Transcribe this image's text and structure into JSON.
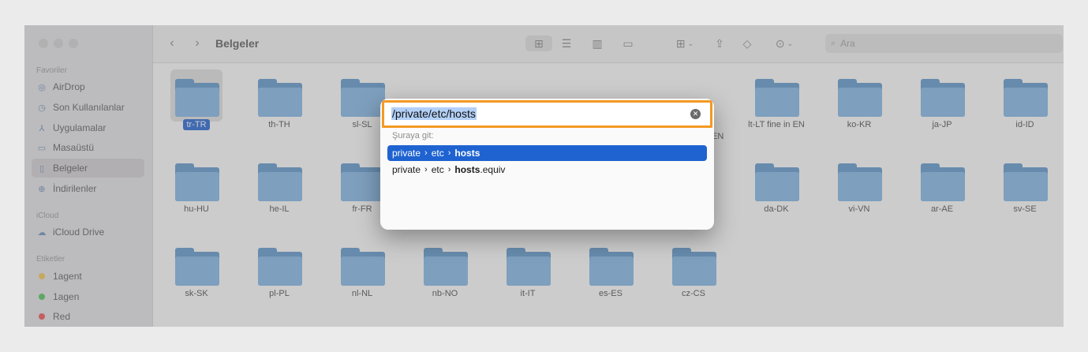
{
  "window": {
    "title": "Belgeler",
    "search_placeholder": "Ara"
  },
  "sidebar": {
    "sections": [
      {
        "title": "Favoriler",
        "items": [
          {
            "label": "AirDrop",
            "icon": "airdrop-icon"
          },
          {
            "label": "Son Kullanılanlar",
            "icon": "clock-icon"
          },
          {
            "label": "Uygulamalar",
            "icon": "apps-icon"
          },
          {
            "label": "Masaüstü",
            "icon": "desktop-icon"
          },
          {
            "label": "Belgeler",
            "icon": "document-icon",
            "active": true
          },
          {
            "label": "İndirilenler",
            "icon": "download-icon"
          }
        ]
      },
      {
        "title": "iCloud",
        "items": [
          {
            "label": "iCloud Drive",
            "icon": "cloud-icon"
          }
        ]
      },
      {
        "title": "Etiketler",
        "items": [
          {
            "label": "1agent",
            "color": "#f5c64d"
          },
          {
            "label": "1agen",
            "color": "#4cc35a"
          },
          {
            "label": "Red",
            "color": "#f0524f"
          }
        ]
      }
    ]
  },
  "folders": [
    [
      "tr-TR",
      "th-TH",
      "sl-SL",
      "",
      "",
      "",
      "",
      "lt-LT fine in EN",
      "ko-KR",
      "ja-JP",
      "id-ID"
    ],
    [
      "hu-HU",
      "he-IL",
      "fr-FR",
      "",
      "",
      "",
      "",
      "da-DK",
      "vi-VN",
      "ar-AE",
      "sv-SE"
    ],
    [
      "sk-SK",
      "pl-PL",
      "nl-NL",
      "nb-NO",
      "it-IT",
      "es-ES",
      "cz-CS"
    ]
  ],
  "hidden_label_fragment": "EN",
  "dialog": {
    "input_value": "/private/etc/hosts",
    "goto_label": "Şuraya git:",
    "suggestions": [
      {
        "parts": [
          "private",
          "etc"
        ],
        "last_bold": "hosts",
        "last_rest": "",
        "selected": true
      },
      {
        "parts": [
          "private",
          "etc"
        ],
        "last_bold": "hosts",
        "last_rest": ".equiv",
        "selected": false
      }
    ]
  }
}
